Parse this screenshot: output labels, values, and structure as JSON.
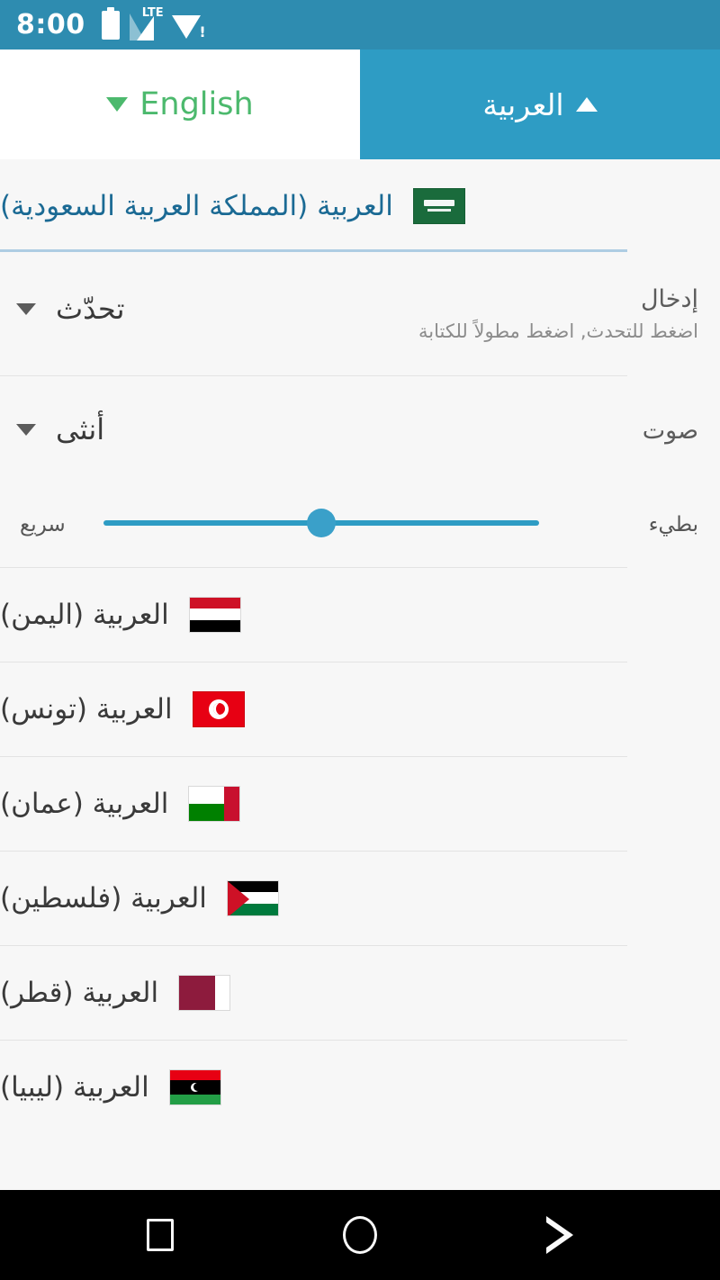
{
  "status_bar": {
    "time": "8:00",
    "battery_icon": "battery-icon",
    "signal_icon": "lte-signal-icon",
    "signal_label": "LTE",
    "wifi_icon": "wifi-warning-icon",
    "wifi_badge": "!",
    "background_color": "#2e8cb0"
  },
  "tabs": [
    {
      "label": "English",
      "caret": "down",
      "state": "inactive",
      "text_color": "#4cb96d",
      "background_color": "#ffffff"
    },
    {
      "label": "العربية",
      "caret": "up",
      "state": "active",
      "text_color": "#ffffff",
      "background_color": "#2e9cc4"
    }
  ],
  "selected_language": {
    "name": "العربية (المملكة العربية السعودية)",
    "flag": "flag-saudi-arabia",
    "selected": true,
    "text_color": "#1b6a94",
    "underline_color": "#aecde3"
  },
  "settings": {
    "input": {
      "title": "إدخال",
      "subtitle": "اضغط للتحدث, اضغط مطولاً للكتابة",
      "value": "تحدّث",
      "caret": "down"
    },
    "voice": {
      "title": "صوت",
      "value": "أنثى",
      "caret": "down"
    },
    "speed_slider": {
      "right_label": "بطيء",
      "left_label": "سريع",
      "value_percent": 50,
      "track_color": "#2e9cc4",
      "thumb_color": "#3aa0c9"
    }
  },
  "languages": [
    {
      "name": "العربية (اليمن)",
      "flag": "flag-yemen"
    },
    {
      "name": "العربية (تونس)",
      "flag": "flag-tunisia"
    },
    {
      "name": "العربية (عمان)",
      "flag": "flag-oman"
    },
    {
      "name": "العربية (فلسطين)",
      "flag": "flag-palestine"
    },
    {
      "name": "العربية (قطر)",
      "flag": "flag-qatar"
    },
    {
      "name": "العربية (ليبيا)",
      "flag": "flag-libya"
    }
  ],
  "navigation_bar": {
    "recents": "square-recents-icon",
    "home": "circle-home-icon",
    "back": "triangle-back-icon",
    "background_color": "#000000"
  }
}
